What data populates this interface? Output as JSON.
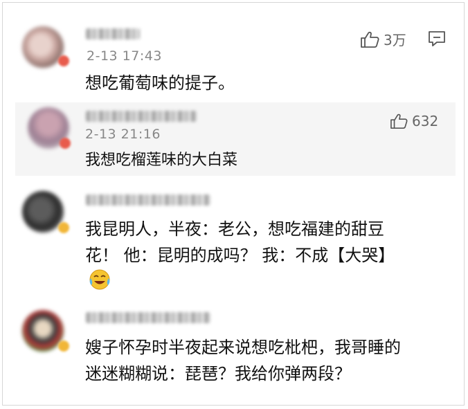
{
  "comments": [
    {
      "time": "2-13 17:43",
      "text": "想吃葡萄味的提子。",
      "likes": "3万"
    },
    {
      "time": "2-13 21:16",
      "text": "我想吃榴莲味的大白菜",
      "likes": "632"
    },
    {
      "text_line1": "我昆明人，半夜：老公，想吃福建的甜豆",
      "text_line2": "花！ 他：昆明的成吗？ 我：不成【大哭】",
      "emoji": "crying-laughing-emoji"
    },
    {
      "text_line1": "嫂子怀孕时半夜起来说想吃枇杷，我哥睡的",
      "text_line2": "迷迷糊糊说：琵琶？我给你弹两段？"
    }
  ],
  "icons": {
    "like": "thumbs-up-icon",
    "comment": "comment-icon"
  },
  "colors": {
    "text": "#111111",
    "meta": "#888888",
    "reply_bg": "#f5f5f5"
  }
}
